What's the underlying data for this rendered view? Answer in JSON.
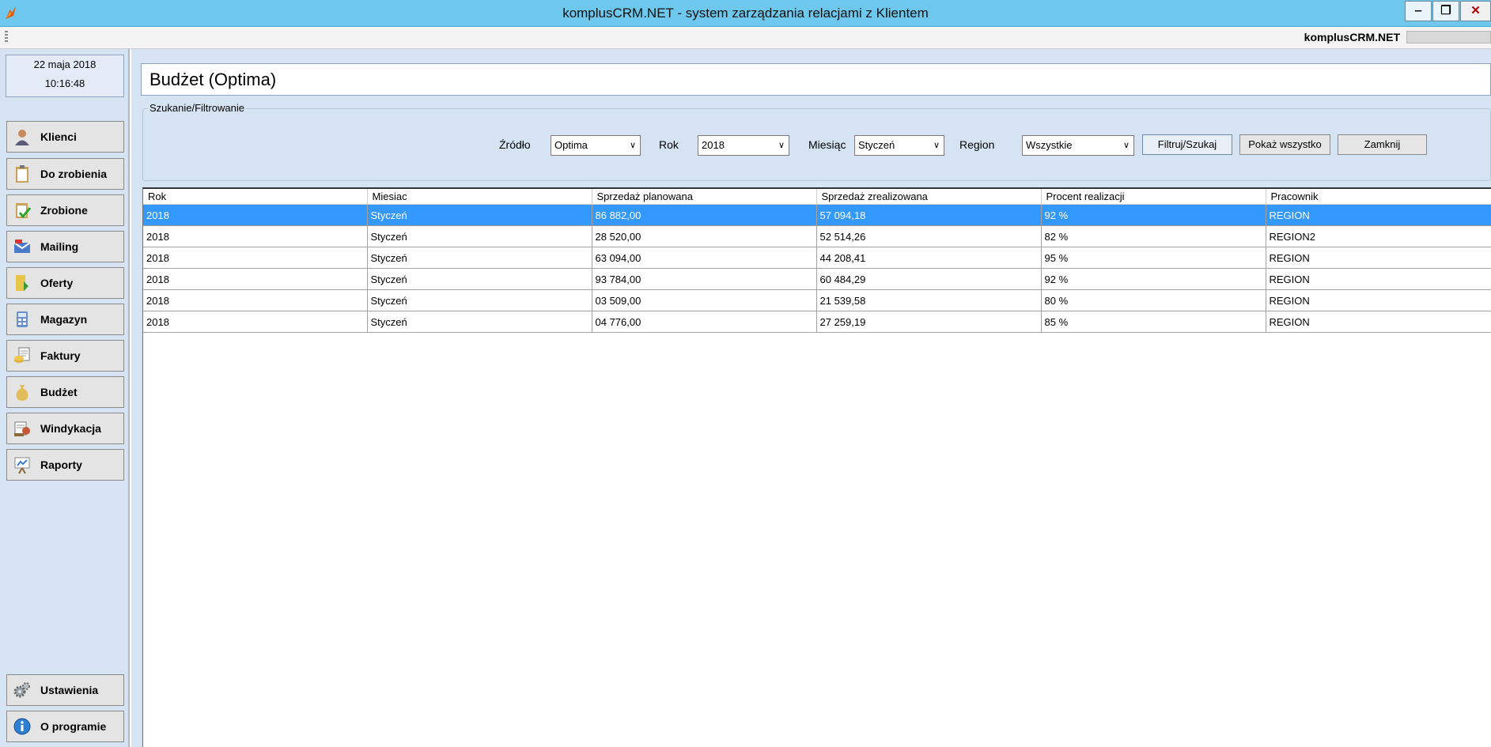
{
  "window": {
    "title": "komplusCRM.NET - system zarządzania relacjami z Klientem",
    "min_label": "‒",
    "max_label": "❐",
    "close_label": "✕"
  },
  "toolstrip": {
    "brand": "komplusCRM.NET"
  },
  "sidebar": {
    "date": "22 maja 2018",
    "time": "10:16:48",
    "items": [
      {
        "label": "Klienci",
        "icon": "user-icon"
      },
      {
        "label": "Do zrobienia",
        "icon": "clipboard-icon"
      },
      {
        "label": "Zrobione",
        "icon": "clipboard-check-icon"
      },
      {
        "label": "Mailing",
        "icon": "mail-icon"
      },
      {
        "label": "Oferty",
        "icon": "folder-icon"
      },
      {
        "label": "Magazyn",
        "icon": "calculator-icon"
      },
      {
        "label": "Faktury",
        "icon": "invoice-icon"
      },
      {
        "label": "Budżet",
        "icon": "money-bag-icon"
      },
      {
        "label": "Windykacja",
        "icon": "debt-collection-icon"
      },
      {
        "label": "Raporty",
        "icon": "report-board-icon"
      }
    ],
    "bottom_items": [
      {
        "label": "Ustawienia",
        "icon": "gears-icon"
      },
      {
        "label": "O programie",
        "icon": "info-icon"
      }
    ]
  },
  "page": {
    "title": "Budżet (Optima)"
  },
  "filter": {
    "legend": "Szukanie/Filtrowanie",
    "source_label": "Źródło",
    "source_value": "Optima",
    "year_label": "Rok",
    "year_value": "2018",
    "month_label": "Miesiąc",
    "month_value": "Styczeń",
    "region_label": "Region",
    "region_value": "Wszystkie",
    "filter_button": "Filtruj/Szukaj",
    "show_all_button": "Pokaż wszystko",
    "close_button": "Zamknij"
  },
  "grid": {
    "columns": [
      "Rok",
      "Miesiac",
      "Sprzedaż planowana",
      "Sprzedaż zrealizowana",
      "Procent realizacji",
      "Pracownik"
    ],
    "rows": [
      [
        "2018",
        "Styczeń",
        "86 882,00",
        "57 094,18",
        "92 %",
        "REGION"
      ],
      [
        "2018",
        "Styczeń",
        "28 520,00",
        "52 514,26",
        "82 %",
        "REGION2"
      ],
      [
        "2018",
        "Styczeń",
        "63 094,00",
        "44 208,41",
        "95 %",
        "REGION"
      ],
      [
        "2018",
        "Styczeń",
        "93 784,00",
        "60 484,29",
        "92 %",
        "REGION"
      ],
      [
        "2018",
        "Styczeń",
        "03 509,00",
        "21 539,58",
        "80 %",
        "REGION"
      ],
      [
        "2018",
        "Styczeń",
        "04 776,00",
        "27 259,19",
        "85 %",
        "REGION"
      ]
    ],
    "selected_row": 0,
    "selection_color": "#3399ff"
  }
}
